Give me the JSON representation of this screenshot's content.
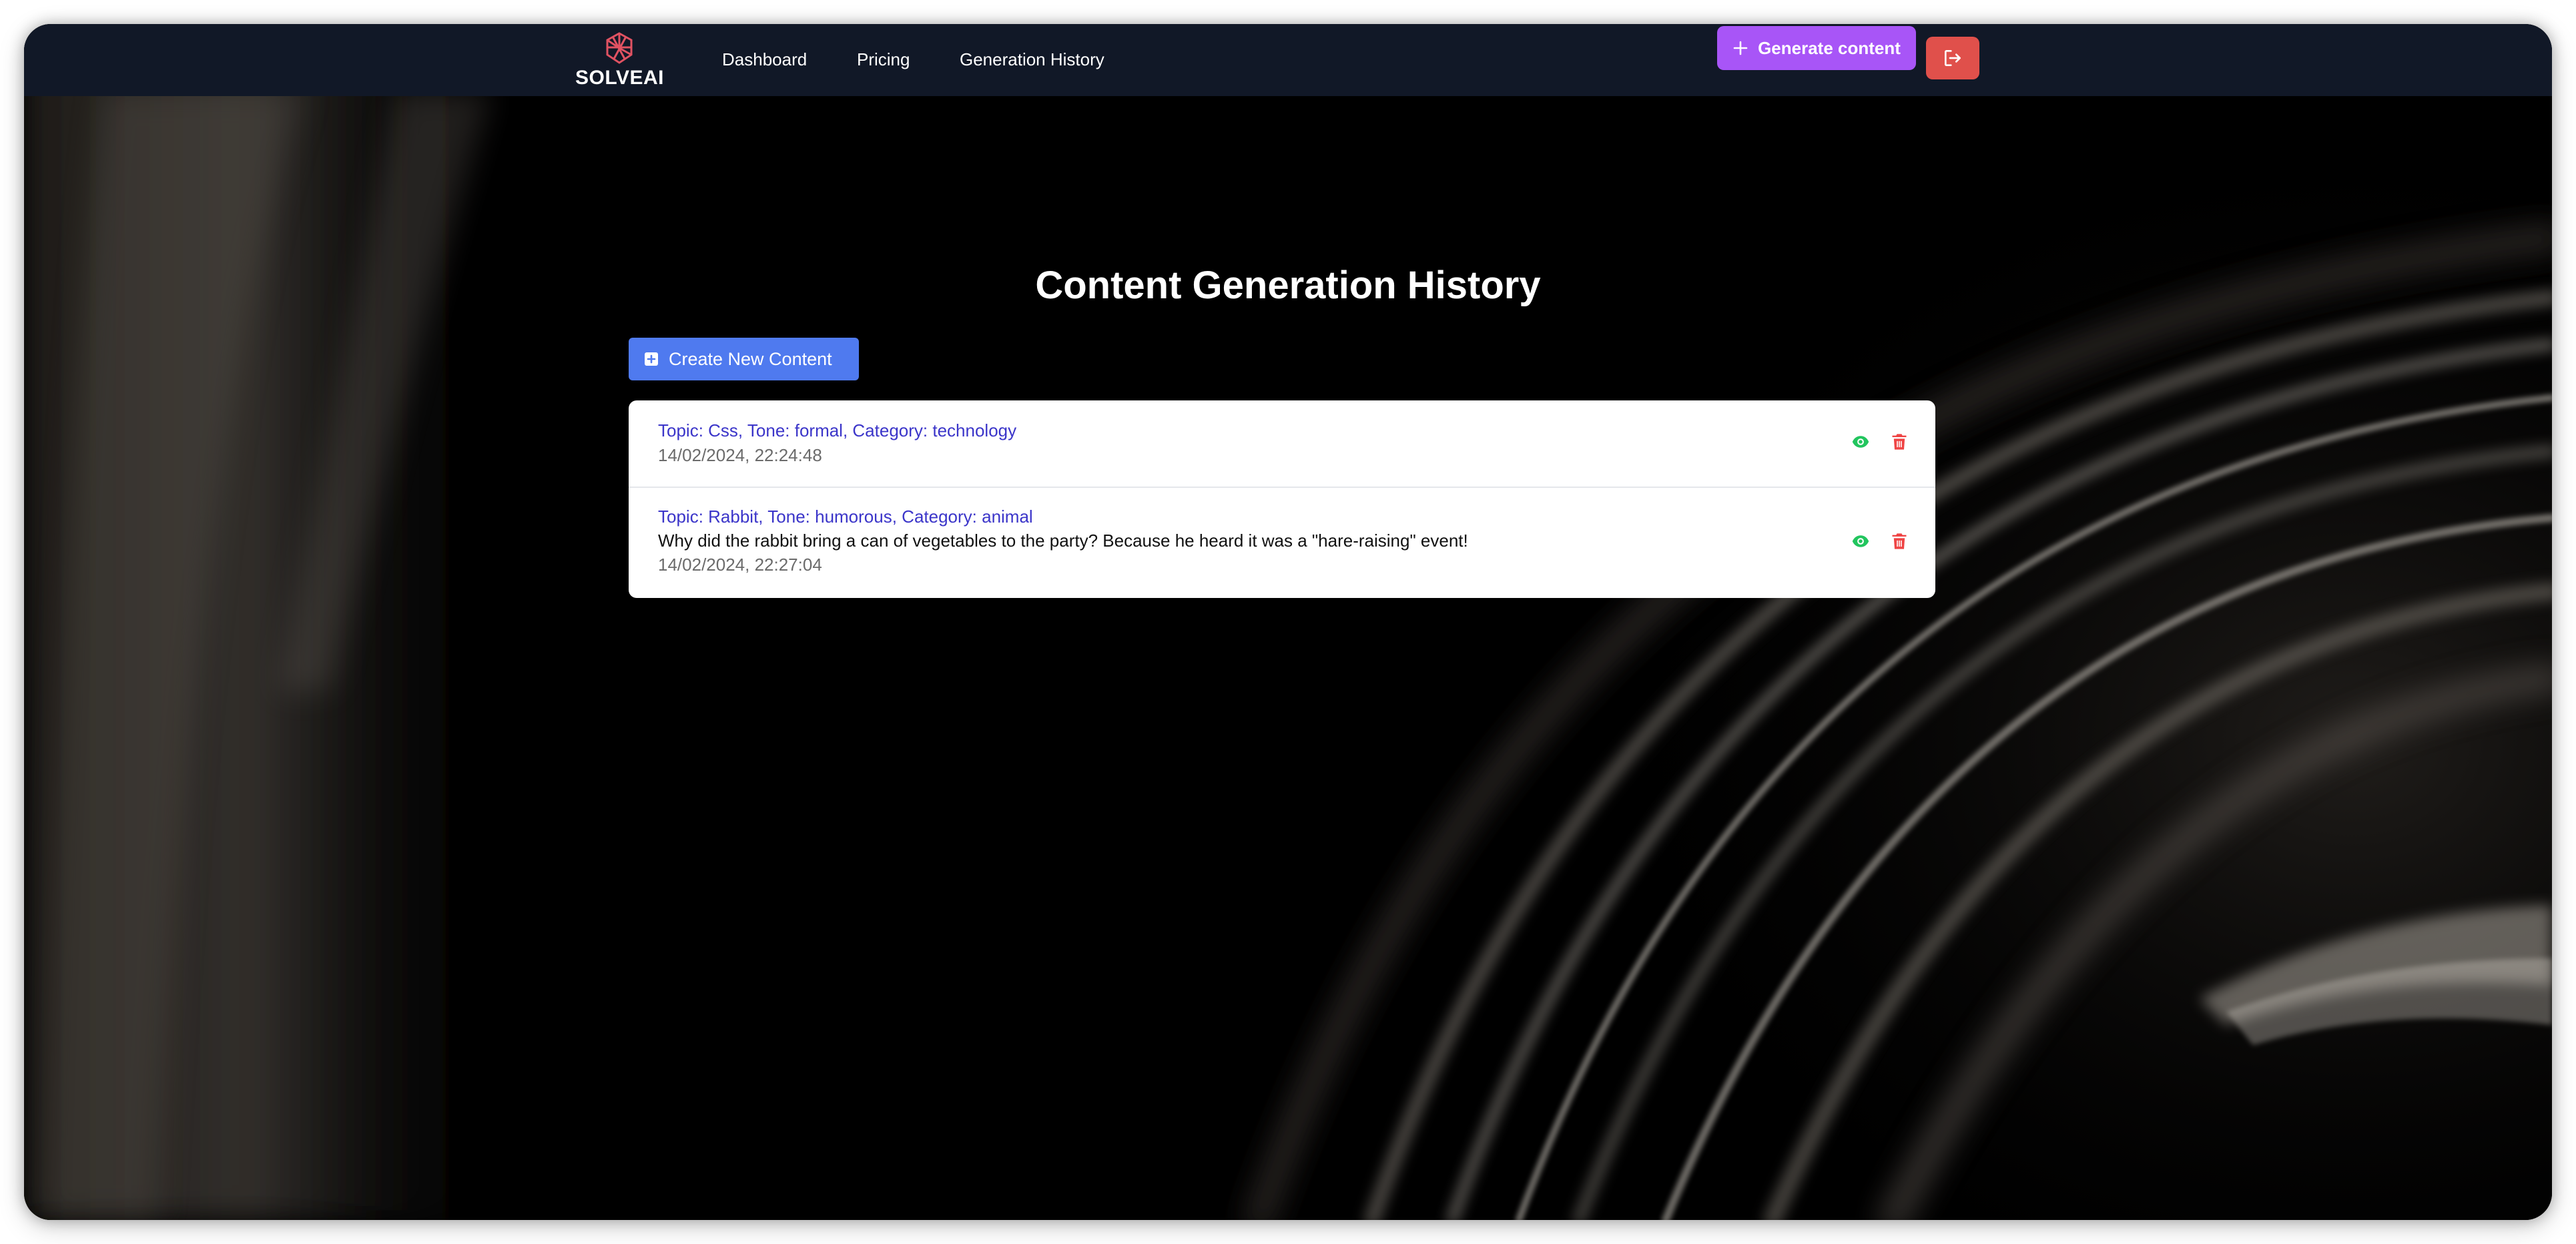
{
  "app": {
    "brand": "SOLVEAI",
    "accent_color": "#a855f7",
    "danger_color": "#e0504b",
    "primary_color": "#4f7aef"
  },
  "nav": {
    "links": [
      {
        "label": "Dashboard"
      },
      {
        "label": "Pricing"
      },
      {
        "label": "Generation History"
      }
    ],
    "generate_label": "Generate content",
    "generate_icon": "plus-icon",
    "logout_icon": "logout-icon"
  },
  "main": {
    "title": "Content Generation History",
    "create_label": "Create New Content",
    "create_icon": "plus-square-icon"
  },
  "history": [
    {
      "meta": "Topic: Css, Tone: formal, Category: technology",
      "content": "",
      "date": "14/02/2024, 22:24:48"
    },
    {
      "meta": "Topic: Rabbit, Tone: humorous, Category: animal",
      "content": "Why did the rabbit bring a can of vegetables to the party? Because he heard it was a \"hare-raising\" event!",
      "date": "14/02/2024, 22:27:04"
    }
  ],
  "item_actions": {
    "view_icon": "eye-icon",
    "delete_icon": "trash-icon",
    "view_color": "#22c55e",
    "delete_color": "#ef4444"
  }
}
